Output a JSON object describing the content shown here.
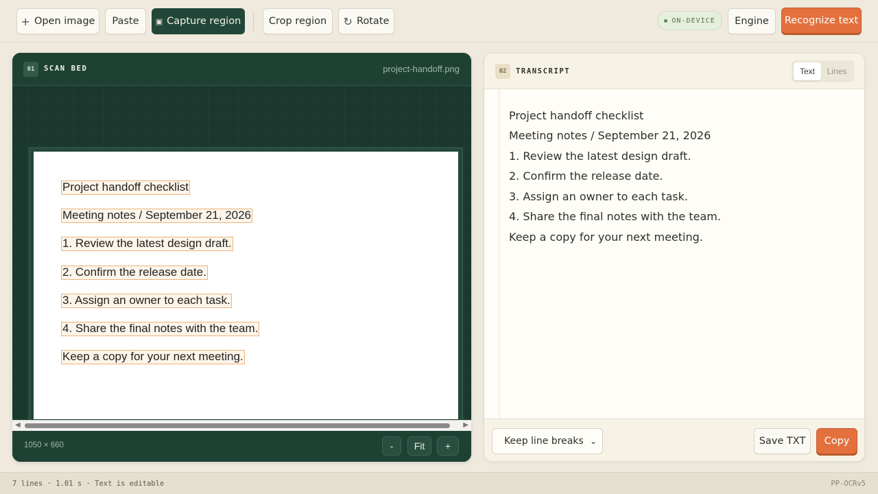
{
  "toolbar": {
    "open_image": "Open image",
    "paste": "Paste",
    "capture_region": "Capture region",
    "crop_region": "Crop region",
    "rotate": "Rotate",
    "on_device": "ON-DEVICE",
    "engine": "Engine",
    "recognize_text": "Recognize text"
  },
  "scan_bed": {
    "number": "01",
    "title": "SCAN BED",
    "file_name": "project-handoff.png",
    "dimensions": "1050 × 660",
    "zoom_out": "-",
    "fit": "Fit",
    "zoom_in": "+",
    "detected_lines": [
      "Project handoff checklist",
      "Meeting notes / September 21, 2026",
      "1. Review the latest design draft.",
      "2. Confirm the release date.",
      "3. Assign an owner to each task.",
      "4. Share the final notes with the team.",
      "Keep a copy for your next meeting."
    ]
  },
  "transcript": {
    "number": "02",
    "title": "TRANSCRIPT",
    "view_text": "Text",
    "view_lines": "Lines",
    "lines": [
      "Project handoff checklist",
      "Meeting notes / September 21, 2026",
      "1. Review the latest design draft.",
      "2. Confirm the release date.",
      "3. Assign an owner to each task.",
      "4. Share the final notes with the team.",
      "Keep a copy for your next meeting."
    ],
    "line_break_mode": "Keep line breaks",
    "save_txt": "Save TXT",
    "copy": "Copy"
  },
  "status": {
    "summary": "7 lines · 1.01 s · Text is editable",
    "model": "PP-OCRv5"
  },
  "colors": {
    "accent": "#e3703d",
    "scan_bg": "#1c3a30",
    "highlight": "#eeb27a"
  }
}
